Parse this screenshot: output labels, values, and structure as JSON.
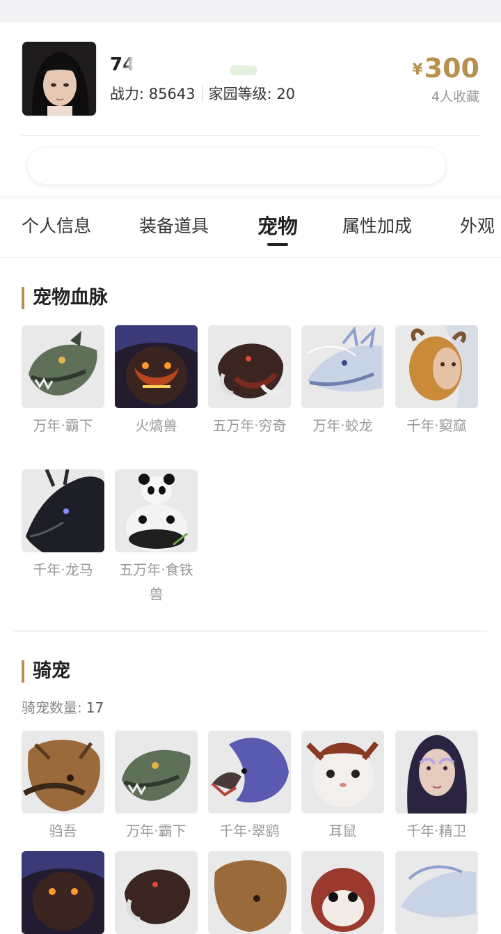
{
  "seller": {
    "name_visible": "74",
    "power_label": "战力:",
    "power_value": "85643",
    "home_label": "家园等级:",
    "home_value": "20"
  },
  "price": {
    "currency": "¥",
    "amount": "300",
    "favorites": "4人收藏"
  },
  "tabs": [
    {
      "label": "个人信息",
      "active": false
    },
    {
      "label": "装备道具",
      "active": false
    },
    {
      "label": "宠物",
      "active": true
    },
    {
      "label": "属性加成",
      "active": false
    },
    {
      "label": "外观",
      "active": false
    }
  ],
  "bloodline": {
    "title": "宠物血脉",
    "items": [
      {
        "label": "万年·霸下",
        "icon": "green-dragon-head-icon"
      },
      {
        "label": "火熇兽",
        "icon": "fire-beast-icon"
      },
      {
        "label": "五万年·穷奇",
        "icon": "tusked-beast-icon"
      },
      {
        "label": "万年·蛟龙",
        "icon": "white-dragon-icon"
      },
      {
        "label": "千年·窫窳",
        "icon": "horned-maiden-icon"
      },
      {
        "label": "千年·龙马",
        "icon": "black-dragon-horse-icon"
      },
      {
        "label": "五万年·食铁兽",
        "icon": "panda-icon"
      }
    ]
  },
  "mounts": {
    "title": "骑宠",
    "count_label": "骑宠数量:",
    "count_value": "17",
    "items": [
      {
        "label": "驺吾",
        "icon": "maned-beast-icon"
      },
      {
        "label": "万年·霸下",
        "icon": "green-dragon-head-icon"
      },
      {
        "label": "千年·翠鹞",
        "icon": "blue-bird-icon"
      },
      {
        "label": "耳鼠",
        "icon": "white-rodent-icon"
      },
      {
        "label": "千年·精卫",
        "icon": "feather-maiden-icon"
      },
      {
        "label": "",
        "icon": "fire-beast-icon"
      },
      {
        "label": "",
        "icon": "tusked-beast-icon"
      },
      {
        "label": "",
        "icon": "maned-beast-icon"
      },
      {
        "label": "",
        "icon": "red-panda-icon"
      },
      {
        "label": "",
        "icon": "white-dragon-icon"
      }
    ]
  },
  "colors": {
    "accent": "#b8904e",
    "text": "#222222",
    "muted": "#999999"
  }
}
